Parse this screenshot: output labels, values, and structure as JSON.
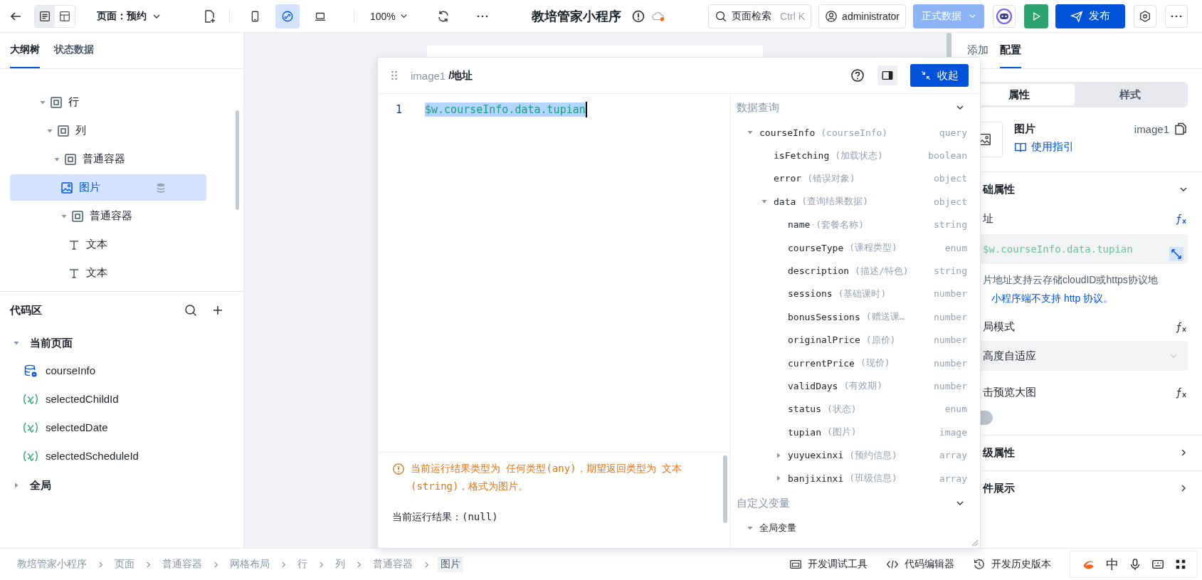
{
  "topbar": {
    "view_toggles": [
      {
        "kind": "list",
        "selected": true
      },
      {
        "kind": "layout",
        "selected": false
      }
    ],
    "page_selector": "页面：预约",
    "devices": [
      {
        "kind": "mobile",
        "selected": false
      },
      {
        "kind": "link",
        "selected": true
      },
      {
        "kind": "laptop",
        "selected": false
      }
    ],
    "zoom": "100%",
    "app_title": "教培管家小程序",
    "search": {
      "label": "页面检索",
      "shortcut": "Ctrl K"
    },
    "user": "administrator",
    "env": "正式数据",
    "publish": "发布"
  },
  "left": {
    "tabs": [
      {
        "label": "大纲树",
        "selected": true
      },
      {
        "label": "状态数据",
        "selected": false
      }
    ],
    "outline": [
      {
        "label": "行",
        "kind": "container",
        "selected": false,
        "expanded": true,
        "children": [
          {
            "label": "列",
            "kind": "container",
            "selected": false,
            "expanded": true,
            "children": [
              {
                "label": "普通容器",
                "kind": "container",
                "selected": false,
                "expanded": true,
                "children": [
                  {
                    "label": "图片",
                    "kind": "image",
                    "selected": true,
                    "bound": true
                  },
                  {
                    "label": "普通容器",
                    "kind": "container",
                    "selected": false,
                    "expanded": true,
                    "children": [
                      {
                        "label": "文本",
                        "kind": "text",
                        "selected": false
                      },
                      {
                        "label": "文本",
                        "kind": "text",
                        "selected": false
                      }
                    ]
                  }
                ]
              }
            ]
          }
        ]
      }
    ],
    "code_area": {
      "title": "代码区",
      "groups": [
        {
          "label": "当前页面",
          "expanded": true,
          "items": [
            {
              "kind": "query",
              "name": "courseInfo"
            },
            {
              "kind": "variable",
              "name": "selectedChildId"
            },
            {
              "kind": "variable",
              "name": "selectedDate"
            },
            {
              "kind": "variable",
              "name": "selectedScheduleId"
            }
          ]
        },
        {
          "label": "全局",
          "expanded": false
        }
      ]
    }
  },
  "popup": {
    "component": "image1",
    "field": "/地址",
    "collapse_button": "收起",
    "editor": {
      "lines": [
        {
          "number": "1",
          "code": "$w.courseInfo.data.tupian",
          "selected": true
        }
      ]
    },
    "warning": "当前运行结果类型为 任何类型(any)，期望返回类型为 文本(string)，格式为图片。",
    "result": "当前运行结果：(null)",
    "sections": [
      {
        "title": "数据查询",
        "expanded": true,
        "tree": [
          {
            "name": "courseInfo",
            "desc": "(courseInfo)",
            "type": "query",
            "expanded": true,
            "children": [
              {
                "name": "isFetching",
                "desc": "(加载状态)",
                "type": "boolean"
              },
              {
                "name": "error",
                "desc": "(错误对象)",
                "type": "object"
              },
              {
                "name": "data",
                "desc": "(查询结果数据)",
                "type": "object",
                "expanded": true,
                "children": [
                  {
                    "name": "name",
                    "desc": "(套餐名称)",
                    "type": "string"
                  },
                  {
                    "name": "courseType",
                    "desc": "(课程类型)",
                    "type": "enum"
                  },
                  {
                    "name": "description",
                    "desc": "(描述/特色)",
                    "type": "string"
                  },
                  {
                    "name": "sessions",
                    "desc": "(基础课时)",
                    "type": "number"
                  },
                  {
                    "name": "bonusSessions",
                    "desc": "(赠送课…",
                    "type": "number"
                  },
                  {
                    "name": "originalPrice",
                    "desc": "(原价)",
                    "type": "number"
                  },
                  {
                    "name": "currentPrice",
                    "desc": "(现价)",
                    "type": "number"
                  },
                  {
                    "name": "validDays",
                    "desc": "(有效期)",
                    "type": "number"
                  },
                  {
                    "name": "status",
                    "desc": "(状态)",
                    "type": "enum"
                  },
                  {
                    "name": "tupian",
                    "desc": "(图片)",
                    "type": "image"
                  },
                  {
                    "name": "yuyuexinxi",
                    "desc": "(预约信息)",
                    "type": "array",
                    "expanded": false
                  },
                  {
                    "name": "banjixinxi",
                    "desc": "(班级信息)",
                    "type": "array",
                    "expanded": false
                  }
                ]
              }
            ]
          }
        ]
      },
      {
        "title": "自定义变量",
        "expanded": true,
        "tree": [
          {
            "name": "全局变量",
            "expanded": true
          }
        ]
      }
    ]
  },
  "right": {
    "tabs": [
      {
        "label": "添加",
        "selected": false
      },
      {
        "label": "配置",
        "selected": true
      }
    ],
    "segments": [
      {
        "label": "属性",
        "selected": true
      },
      {
        "label": "样式",
        "selected": false
      }
    ],
    "component": {
      "name": "图片",
      "guide": "使用指引",
      "id": "image1"
    },
    "sections": [
      {
        "title": "础属性",
        "expanded": true,
        "fields": [
          {
            "kind": "expression",
            "label": "址",
            "value": "$w.courseInfo.data.tupian",
            "help": "片地址支持云存储cloudID或https协议地",
            "help_link": "小程序端不支持 http 协议。"
          },
          {
            "kind": "select",
            "label": "局模式",
            "value": "高度自适应"
          },
          {
            "kind": "switch",
            "label": "击预览大图",
            "on": false
          }
        ]
      },
      {
        "title": "级属性",
        "expanded": false
      },
      {
        "title": "件展示",
        "expanded": false
      }
    ]
  },
  "bottom": {
    "breadcrumbs": [
      {
        "label": "教培管家小程序",
        "selected": false
      },
      {
        "label": "页面",
        "selected": false
      },
      {
        "label": "普通容器",
        "selected": false
      },
      {
        "label": "网格布局",
        "selected": false
      },
      {
        "label": "行",
        "selected": false
      },
      {
        "label": "列",
        "selected": false
      },
      {
        "label": "普通容器",
        "selected": false
      },
      {
        "label": "图片",
        "selected": true
      }
    ],
    "tools": [
      {
        "kind": "debug",
        "label": "开发调试工具"
      },
      {
        "kind": "code",
        "label": "代码编辑器"
      },
      {
        "kind": "history",
        "label": "开发历史版本"
      }
    ],
    "ime": {
      "mode": "中"
    }
  }
}
